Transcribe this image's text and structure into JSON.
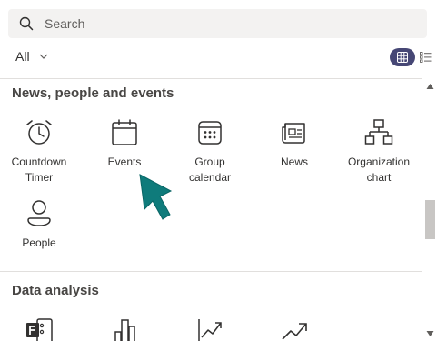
{
  "search": {
    "placeholder": "Search"
  },
  "filter": {
    "selected": "All"
  },
  "sections": [
    {
      "title": "News, people and events",
      "tiles": [
        {
          "label": "Countdown Timer",
          "icon": "alarm-clock-icon"
        },
        {
          "label": "Events",
          "icon": "calendar-icon"
        },
        {
          "label": "Group calendar",
          "icon": "group-calendar-icon"
        },
        {
          "label": "News",
          "icon": "newspaper-icon"
        },
        {
          "label": "Organization chart",
          "icon": "org-chart-icon"
        },
        {
          "label": "People",
          "icon": "person-icon"
        }
      ]
    },
    {
      "title": "Data analysis",
      "tiles": [
        {
          "label": "",
          "icon": "forms-icon"
        },
        {
          "label": "",
          "icon": "bar-chart-icon"
        },
        {
          "label": "",
          "icon": "line-chart-icon"
        },
        {
          "label": "",
          "icon": "trending-icon"
        }
      ]
    }
  ],
  "colors": {
    "accent": "#464775",
    "cursor": "#0f7b7b",
    "icon": "#323130"
  }
}
